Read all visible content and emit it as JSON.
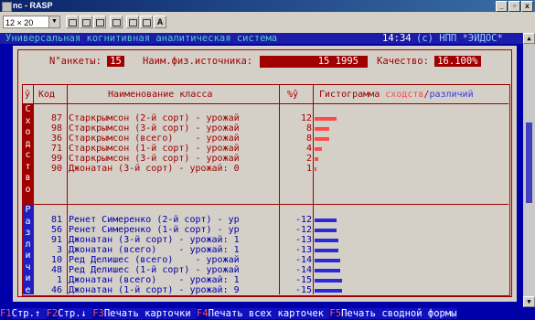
{
  "window": {
    "title": "nc - RASP",
    "minimize": "_",
    "maximize": "▫",
    "close": "x"
  },
  "toolbar": {
    "font_size": "12 × 20",
    "bold_button": "A"
  },
  "system": {
    "title": "Универсальная когнитивная аналитическая система",
    "time": "14:34",
    "copyright": "(c) НПП *ЭЙДОС*"
  },
  "header": {
    "survey_label": "N°анкеты:",
    "survey_value": "15",
    "source_label": "Наим.физ.источника:",
    "source_value": "15 1995",
    "quality_label": "Качество:",
    "quality_value": "16.100%"
  },
  "columns": {
    "marker": "ŷ",
    "code": "Код",
    "name": "Наименование класса",
    "pct": "%ŷ",
    "histogram_part1": "Гистограмма ",
    "histogram_similar": "сходств",
    "histogram_sep": "/",
    "histogram_diff": "различий"
  },
  "similarity": {
    "side_label": [
      "С",
      "х",
      "о",
      "д",
      "с",
      "т",
      "в",
      "о"
    ],
    "rows": [
      {
        "code": "87",
        "name": "Старкрымсон (2-й сорт) - урожай",
        "pct": "12",
        "value": 12
      },
      {
        "code": "98",
        "name": "Старкрымсон (3-й сорт) - урожай",
        "pct": "8",
        "value": 8
      },
      {
        "code": "36",
        "name": "Старкрымсон (всего)    - урожай",
        "pct": "8",
        "value": 8
      },
      {
        "code": "71",
        "name": "Старкрымсон (1-й сорт) - урожай",
        "pct": "4",
        "value": 4
      },
      {
        "code": "99",
        "name": "Старкрымсон (3-й сорт) - урожай",
        "pct": "2",
        "value": 2
      },
      {
        "code": "90",
        "name": "Джонатан (3-й сорт) - урожай: 0",
        "pct": "1",
        "value": 1
      }
    ]
  },
  "difference": {
    "side_label": [
      "Р",
      "а",
      "з",
      "л",
      "и",
      "ч",
      "и",
      "е"
    ],
    "rows": [
      {
        "code": "81",
        "name": "Ренет Симеренко (2-й сорт) - ур",
        "pct": "-12",
        "value": -12
      },
      {
        "code": "56",
        "name": "Ренет Симеренко (1-й сорт) - ур",
        "pct": "-12",
        "value": -12
      },
      {
        "code": "91",
        "name": "Джонатан (3-й сорт) - урожай: 1",
        "pct": "-13",
        "value": -13
      },
      {
        "code": "3",
        "name": "Джонатан (всего)    - урожай: 1",
        "pct": "-13",
        "value": -13
      },
      {
        "code": "10",
        "name": "Ред Делишес (всего)    - урожай",
        "pct": "-14",
        "value": -14
      },
      {
        "code": "48",
        "name": "Ред Делишес (1-й сорт) - урожай",
        "pct": "-14",
        "value": -14
      },
      {
        "code": "1",
        "name": "Джонатан (всего)    - урожай: 1",
        "pct": "-15",
        "value": -15
      },
      {
        "code": "46",
        "name": "Джонатан (1-й сорт) - урожай: 9",
        "pct": "-15",
        "value": -15
      }
    ]
  },
  "fkeys": [
    {
      "key": "F1",
      "label": "Стр.↑"
    },
    {
      "key": "F2",
      "label": "Стр.↓"
    },
    {
      "key": "F3",
      "label": "Печать карточки"
    },
    {
      "key": "F4",
      "label": "Печать всех карточек"
    },
    {
      "key": "F5",
      "label": "Печать сводной формы"
    }
  ],
  "colors": {
    "similar_bar": "#ff4a4a",
    "diff_bar": "#2a2ad8",
    "screen_bg": "#0000a8",
    "accent": "#a00000"
  }
}
